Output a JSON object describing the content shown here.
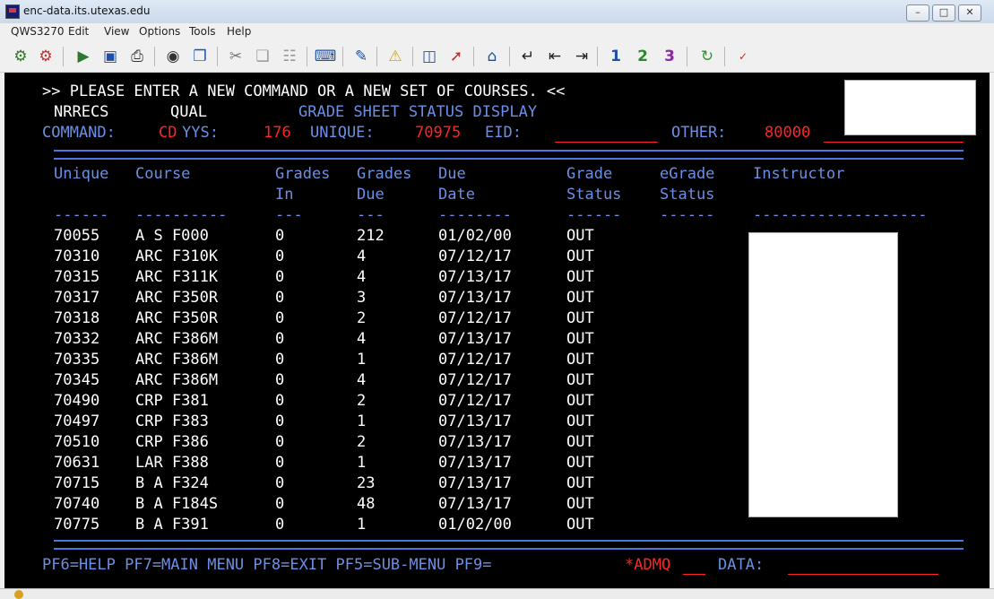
{
  "window": {
    "title": "enc-data.its.utexas.edu"
  },
  "menu": [
    "QWS3270",
    "Edit",
    "View",
    "Options",
    "Tools",
    "Help"
  ],
  "toolbar_icons": [
    "connect-icon",
    "disconnect-icon",
    "record-icon",
    "save-icon",
    "print-icon",
    "camera-icon",
    "copy-screen-icon",
    "cut-icon",
    "copy-icon",
    "paste-icon",
    "keyboard-icon",
    "edit-icon",
    "warning-icon",
    "monitor-icon",
    "transfer-icon",
    "home-icon",
    "enter-icon",
    "tab-back-icon",
    "tab-forward-icon",
    "pa1-icon",
    "pa2-icon",
    "pa3-icon",
    "refresh-icon",
    "spellcheck-icon"
  ],
  "terminal": {
    "prompt": ">> PLEASE ENTER A NEW COMMAND OR A NEW SET OF COURSES. <<",
    "nrrecs_label": "NRRECS",
    "qual_label": "QUAL",
    "screen_title": "GRADE SHEET STATUS DISPLAY",
    "command_label": "COMMAND:",
    "command_value": "CD",
    "yys_label": "YYS:",
    "yys_value": "176",
    "unique_label": "UNIQUE:",
    "unique_value": "70975",
    "eid_label": "EID:",
    "other_label": "OTHER:",
    "other_value": "80000",
    "headers": {
      "unique": "Unique",
      "course": "Course",
      "grades_in_1": "Grades",
      "grades_in_2": "In",
      "grades_due_1": "Grades",
      "grades_due_2": "Due",
      "due_date_1": "Due",
      "due_date_2": "Date",
      "grade_status_1": "Grade",
      "grade_status_2": "Status",
      "egrade_status_1": "eGrade",
      "egrade_status_2": "Status",
      "instructor": "Instructor"
    },
    "dashes": {
      "unique": "------",
      "course": "----------",
      "grades_in": "---",
      "grades_due": "---",
      "due_date": "--------",
      "grade_status": "------",
      "egrade_status": "------",
      "instructor": "-------------------"
    },
    "rows": [
      {
        "unique": "70055",
        "course": "A S F000",
        "grades_in": "0",
        "grades_due": "212",
        "due_date": "01/02/00",
        "status": "OUT"
      },
      {
        "unique": "70310",
        "course": "ARC F310K",
        "grades_in": "0",
        "grades_due": "4",
        "due_date": "07/12/17",
        "status": "OUT"
      },
      {
        "unique": "70315",
        "course": "ARC F311K",
        "grades_in": "0",
        "grades_due": "4",
        "due_date": "07/13/17",
        "status": "OUT"
      },
      {
        "unique": "70317",
        "course": "ARC F350R",
        "grades_in": "0",
        "grades_due": "3",
        "due_date": "07/13/17",
        "status": "OUT"
      },
      {
        "unique": "70318",
        "course": "ARC F350R",
        "grades_in": "0",
        "grades_due": "2",
        "due_date": "07/12/17",
        "status": "OUT"
      },
      {
        "unique": "70332",
        "course": "ARC F386M",
        "grades_in": "0",
        "grades_due": "4",
        "due_date": "07/13/17",
        "status": "OUT"
      },
      {
        "unique": "70335",
        "course": "ARC F386M",
        "grades_in": "0",
        "grades_due": "1",
        "due_date": "07/12/17",
        "status": "OUT"
      },
      {
        "unique": "70345",
        "course": "ARC F386M",
        "grades_in": "0",
        "grades_due": "4",
        "due_date": "07/12/17",
        "status": "OUT"
      },
      {
        "unique": "70490",
        "course": "CRP F381",
        "grades_in": "0",
        "grades_due": "2",
        "due_date": "07/12/17",
        "status": "OUT"
      },
      {
        "unique": "70497",
        "course": "CRP F383",
        "grades_in": "0",
        "grades_due": "1",
        "due_date": "07/13/17",
        "status": "OUT"
      },
      {
        "unique": "70510",
        "course": "CRP F386",
        "grades_in": "0",
        "grades_due": "2",
        "due_date": "07/13/17",
        "status": "OUT"
      },
      {
        "unique": "70631",
        "course": "LAR F388",
        "grades_in": "0",
        "grades_due": "1",
        "due_date": "07/13/17",
        "status": "OUT"
      },
      {
        "unique": "70715",
        "course": "B A F324",
        "grades_in": "0",
        "grades_due": "23",
        "due_date": "07/13/17",
        "status": "OUT"
      },
      {
        "unique": "70740",
        "course": "B A F184S",
        "grades_in": "0",
        "grades_due": "48",
        "due_date": "07/13/17",
        "status": "OUT"
      },
      {
        "unique": "70775",
        "course": "B A F391",
        "grades_in": "0",
        "grades_due": "1",
        "due_date": "01/02/00",
        "status": "OUT"
      }
    ],
    "footer_keys": "PF6=HELP PF7=MAIN MENU PF8=EXIT PF5=SUB-MENU PF9=",
    "footer_admq": "*ADMQ",
    "footer_data_label": "DATA:"
  },
  "colors": {
    "terminal_bg": "#000000",
    "text_white": "#ffffff",
    "text_cyan": "#6b8fe6",
    "text_red": "#ff2424"
  }
}
